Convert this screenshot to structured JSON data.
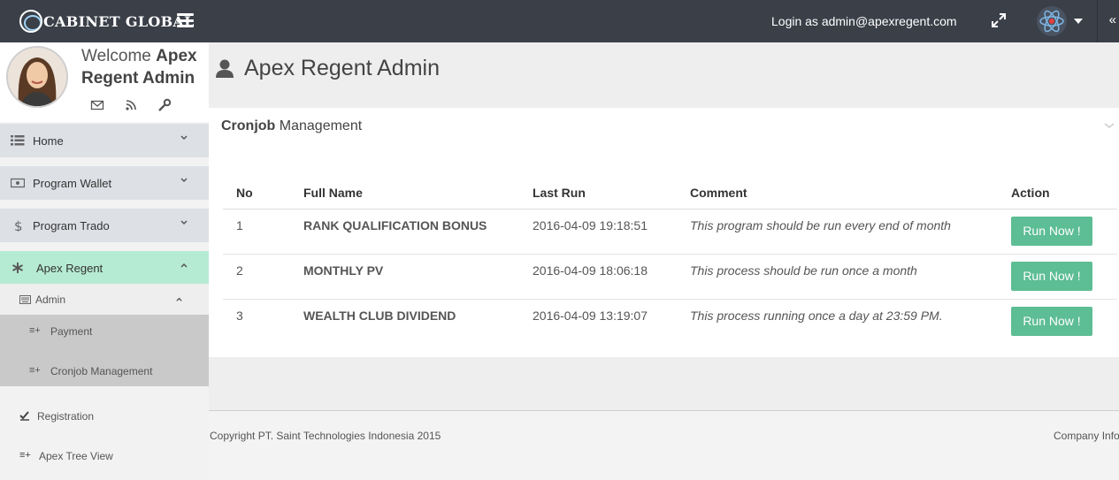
{
  "header": {
    "brand": "CABINET GLOBAL",
    "login_text": "Login as admin@apexregent.com",
    "collapse_glyph": "«"
  },
  "profile": {
    "welcome": "Welcome",
    "name": "Apex Regent Admin",
    "icons": [
      "envelope-icon",
      "rss-icon",
      "wrench-icon"
    ]
  },
  "sidebar": {
    "items": [
      {
        "label": "Home",
        "icon": "list-icon"
      },
      {
        "label": "Program Wallet",
        "icon": "money-icon"
      },
      {
        "label": "Program Trado",
        "icon": "dollar-icon"
      },
      {
        "label": "Apex Regent",
        "icon": "asterisk-icon"
      }
    ],
    "admin": {
      "label": "Admin",
      "icon": "keyboard-icon"
    },
    "admin_children": [
      {
        "label": "Payment"
      },
      {
        "label": "Cronjob Management"
      }
    ],
    "others": [
      {
        "label": "Registration",
        "icon": "check-icon"
      },
      {
        "label": "Apex Tree View",
        "icon": "list-add-icon"
      }
    ]
  },
  "main": {
    "page_title": "Apex Regent Admin",
    "panel_title_bold": "Cronjob",
    "panel_title_rest": "Management",
    "table": {
      "columns": [
        "No",
        "Full Name",
        "Last Run",
        "Comment",
        "Action"
      ],
      "rows": [
        {
          "no": "1",
          "name": "RANK QUALIFICATION BONUS",
          "last_run": "2016-04-09 19:18:51",
          "comment": "This program should be run every end of month",
          "action": "Run Now !"
        },
        {
          "no": "2",
          "name": "MONTHLY PV",
          "last_run": "2016-04-09 18:06:18",
          "comment": "This process should be run once a month",
          "action": "Run Now !"
        },
        {
          "no": "3",
          "name": "WEALTH CLUB DIVIDEND",
          "last_run": "2016-04-09 13:19:07",
          "comment": "This process running once a day at 23:59 PM.",
          "action": "Run Now !"
        }
      ]
    }
  },
  "footer": {
    "copyright": "Copyright PT. Saint Technologies Indonesia 2015",
    "company": "Company Info"
  },
  "colors": {
    "topbar": "#3a3f48",
    "accent_button": "#5dbd94",
    "active_menu": "#b6ebd3"
  }
}
